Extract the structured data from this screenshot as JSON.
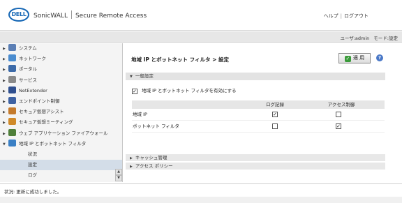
{
  "header": {
    "logo_text": "DELL",
    "product": "SonicWALL",
    "product_sub": "Secure Remote Access",
    "help_link": "ヘルプ",
    "logout_link": "ログアウト",
    "link_separator": "|"
  },
  "userbar": {
    "user_label": "ユーザ:",
    "user_value": "admin",
    "mode_label": "モード:",
    "mode_value": "設定"
  },
  "sidebar": {
    "items": [
      {
        "label": "システム",
        "icon": "monitor-icon",
        "color": "#5b7fb5"
      },
      {
        "label": "ネットワーク",
        "icon": "globe-icon",
        "color": "#4a8ccf"
      },
      {
        "label": "ポータル",
        "icon": "portal-icon",
        "color": "#3c6aa8"
      },
      {
        "label": "サービス",
        "icon": "gear-icon",
        "color": "#8a8a8a"
      },
      {
        "label": "NetExtender",
        "icon": "netextender-icon",
        "color": "#2f4f8f"
      },
      {
        "label": "エンドポイント制御",
        "icon": "shield-icon",
        "color": "#3e62a3"
      },
      {
        "label": "セキュア仮想アシスト",
        "icon": "assist-icon",
        "color": "#c47a2c"
      },
      {
        "label": "セキュア仮想ミーティング",
        "icon": "meeting-icon",
        "color": "#d08a2a"
      },
      {
        "label": "ウェブ アプリケーション ファイアウォール",
        "icon": "firewall-icon",
        "color": "#4f7f3a"
      },
      {
        "label": "地域 IP とボットネット フィルタ",
        "icon": "geo-icon",
        "color": "#3a7fc4"
      }
    ],
    "sub_items": [
      {
        "label": "状況"
      },
      {
        "label": "設定"
      },
      {
        "label": "ログ"
      }
    ],
    "active_sub": 1,
    "scroll_up": "▲",
    "scroll_down": "▼"
  },
  "main": {
    "title": "地域 IP とボットネット フィルタ > 設定",
    "apply_label": "適 用",
    "help_glyph": "?",
    "general_section": "一般設定",
    "enable_label": "地域 IP とボットネット フィルタを有効にする",
    "enable_checked": true,
    "table": {
      "columns": [
        "",
        "ログ記録",
        "アクセス制御"
      ],
      "rows": [
        {
          "name": "地域 IP",
          "log": true,
          "access": false
        },
        {
          "name": "ボットネット フィルタ",
          "log": false,
          "access": true
        }
      ]
    },
    "cache_section": "キャッシュ管理",
    "access_policy_section": "アクセス ポリシー"
  },
  "status": {
    "text": "状況: 更新に成功しました。"
  }
}
